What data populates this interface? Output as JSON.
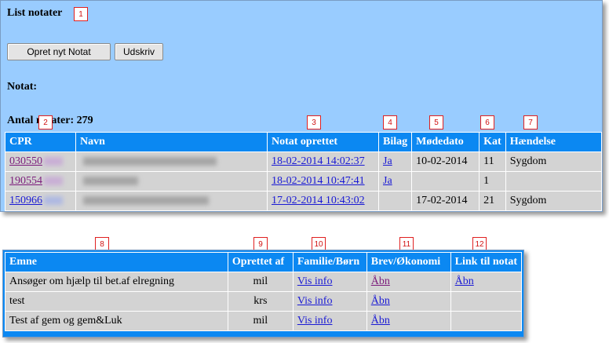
{
  "page": {
    "title": "List notater"
  },
  "toolbar": {
    "new_note_label": "Opret nyt Notat",
    "print_label": "Udskriv"
  },
  "labels": {
    "note": "Notat:",
    "count": "Antal notater: 279"
  },
  "markers": [
    "1",
    "2",
    "3",
    "4",
    "5",
    "6",
    "7",
    "8",
    "9",
    "10",
    "11",
    "12"
  ],
  "notes_table": {
    "headers": [
      "CPR",
      "Navn",
      "Notat oprettet",
      "Bilag",
      "Mødedato",
      "Kat",
      "Hændelse"
    ],
    "rows": [
      {
        "cpr": "030550",
        "created": "18-02-2014 14:02:37",
        "bilag": "Ja",
        "meeting": "10-02-2014",
        "kat": "11",
        "event": "Sygdom"
      },
      {
        "cpr": "190554",
        "created": "18-02-2014 10:47:41",
        "bilag": "Ja",
        "meeting": "",
        "kat": "1",
        "event": ""
      },
      {
        "cpr": "150966",
        "created": "17-02-2014 10:43:02",
        "bilag": "",
        "meeting": "17-02-2014",
        "kat": "21",
        "event": "Sygdom"
      }
    ]
  },
  "detail_table": {
    "headers": [
      "Emne",
      "Oprettet af",
      "Familie/Børn",
      "Brev/Økonomi",
      "Link til notat"
    ],
    "rows": [
      {
        "subject": "Ansøger om hjælp til bet.af elregning",
        "author": "mil",
        "family": "Vis info",
        "letter": "Åbn",
        "link": "Åbn"
      },
      {
        "subject": "test",
        "author": "krs",
        "family": "Vis info",
        "letter": "Åbn",
        "link": ""
      },
      {
        "subject": "Test af gem og gem&Luk",
        "author": "mil",
        "family": "Vis info",
        "letter": "Åbn",
        "link": ""
      }
    ]
  },
  "colors": {
    "panel": "#99ccff",
    "header": "#0b88f2",
    "cell": "#d3d3d3",
    "marker": "#e02020"
  }
}
